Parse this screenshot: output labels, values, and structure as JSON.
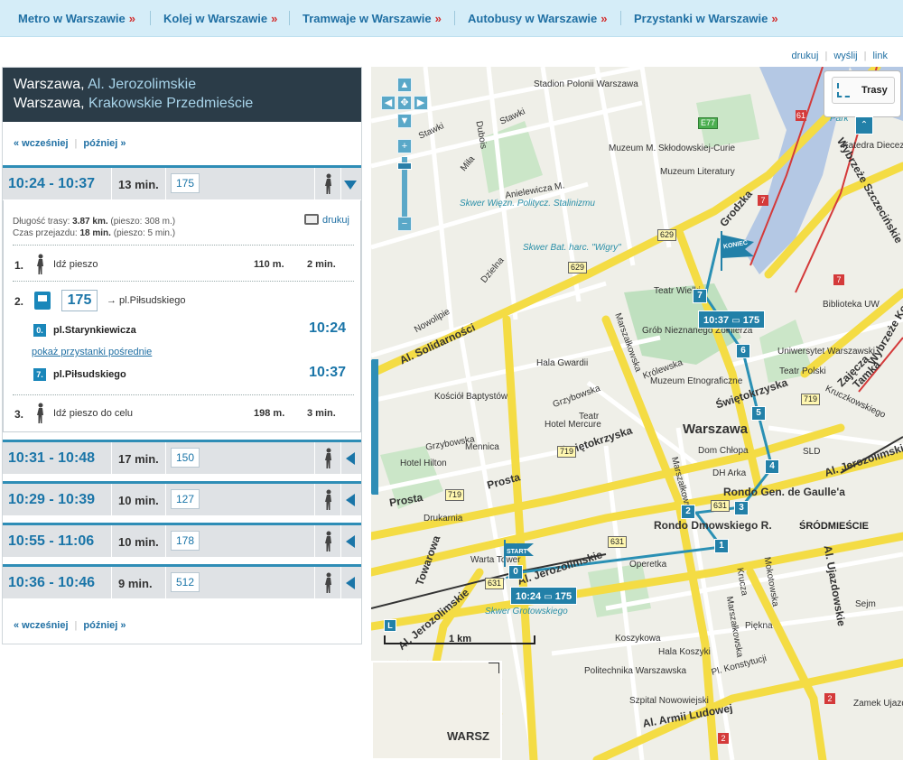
{
  "nav": [
    {
      "label": "Metro w Warszawie"
    },
    {
      "label": "Kolej w Warszawie"
    },
    {
      "label": "Tramwaje w Warszawie"
    },
    {
      "label": "Autobusy w Warszawie"
    },
    {
      "label": "Przystanki w Warszawie"
    }
  ],
  "nav_arrow": "»",
  "utils": {
    "print": "drukuj",
    "send": "wyślij",
    "link": "link"
  },
  "route": {
    "city1": "Warszawa,",
    "from": "Al. Jerozolimskie",
    "city2": "Warszawa,",
    "to": "Krakowskie Przedmieście"
  },
  "pager": {
    "earlier": "« wcześniej",
    "later": "później »"
  },
  "trips": [
    {
      "time": "10:24 - 10:37",
      "duration": "13 min.",
      "line": "175",
      "expanded": true
    },
    {
      "time": "10:31 - 10:48",
      "duration": "17 min.",
      "line": "150"
    },
    {
      "time": "10:29 - 10:39",
      "duration": "10 min.",
      "line": "127"
    },
    {
      "time": "10:55 - 11:06",
      "duration": "10 min.",
      "line": "178"
    },
    {
      "time": "10:36 - 10:46",
      "duration": "9 min.",
      "line": "512"
    }
  ],
  "detail": {
    "length_label": "Długość trasy:",
    "length_value": "3.87 km.",
    "length_walk": "(pieszo: 308 m.)",
    "time_label": "Czas przejazdu:",
    "time_value": "18 min.",
    "time_walk": "(pieszo: 5 min.)",
    "print": "drukuj",
    "steps": [
      {
        "n": "1.",
        "text": "Idź pieszo",
        "dist": "110 m.",
        "dur": "2 min."
      },
      {
        "n": "2.",
        "line": "175",
        "direction": "→ pl.Piłsudskiego",
        "stop_from_no": "0.",
        "stop_from": "pl.Starynkiewicza",
        "time_from": "10:24",
        "show_mid": "pokaż przystanki pośrednie",
        "stop_to_no": "7.",
        "stop_to": "pl.Piłsudskiego",
        "time_to": "10:37"
      },
      {
        "n": "3.",
        "text": "Idź pieszo do celu",
        "dist": "198 m.",
        "dur": "3 min."
      }
    ]
  },
  "map": {
    "trasy_label": "Trasy",
    "scale_label": "1 km",
    "start_tag": "10:24",
    "end_tag": "10:37",
    "line": "175",
    "start_flag": "START",
    "end_flag": "KONIEC",
    "labels": {
      "stadion": "Stadion Polonii Warszawa",
      "muzeum_sklod": "Muzeum M. Skłodowskiej-Curie",
      "muzeum_lit": "Muzeum Literatury",
      "skwer_wiezn": "Skwer Więzn. Politycz. Stalinizmu",
      "skwer_bat": "Skwer Bat. harc. \"Wigry\"",
      "teatr_wielki": "Teatr Wielki",
      "grob": "Grób Nieznanego Żołnierza",
      "uniw": "Uniwersytet Warszawski",
      "teatr_polski": "Teatr Polski",
      "bib": "Biblioteka UW",
      "hala_gwardii": "Hala Gwardii",
      "muzeum_etno": "Muzeum Etnograficzne",
      "kosciol": "Kościół Baptystów",
      "teatr": "Teatr",
      "hotel_mercure": "Hotel Mercure",
      "warszawa": "Warszawa",
      "dom_chlopa": "Dom Chłopa",
      "dh_arka": "DH Arka",
      "sld": "SLD",
      "rondo_gaulle": "Rondo Gen. de Gaulle'a",
      "srodmiescie": "ŚRÓDMIEŚCIE",
      "hotel_hilton": "Hotel Hilton",
      "mennica": "Mennica",
      "drukarnia": "Drukarnia",
      "rondo_dmowskiego": "Rondo Dmowskiego R.",
      "al_solidarnosci": "Al. Solidarności",
      "swietokrzyska": "Świętokrzyska",
      "prosta": "Prosta",
      "al_jerozolimskie": "Al. Jerozolimskie",
      "towarowa": "Towarowa",
      "grodzka": "Grodzka",
      "zajecza": "Zajęcza",
      "tamka": "Tamka",
      "warta": "Warta Tower",
      "operetka": "Operetka",
      "skwer_grot": "Skwer Grotowskiego",
      "koszykowa": "Koszykowa",
      "hala_koszyki": "Hala Koszyki",
      "politechnika": "Politechnika Warszawska",
      "szpital": "Szpital Nowowiejski",
      "piekna": "Piękna",
      "al_armii": "Al. Armii Ludowej",
      "pl_konst": "Pl. Konstytucji",
      "zamek": "Zamek Ujazdów",
      "sejm": "Sejm",
      "katedra": "Katedra Diecezj.",
      "park": "Park",
      "wybrzeze": "Wybrzeże Szczecińskie",
      "wybrzeze2": "Wybrzeże Ko",
      "grzybowska": "Grzybowska",
      "krolewska": "Królewska",
      "marszalkowska": "Marszałkowska",
      "nowolipie": "Nowolipie",
      "dzielna": "Dzielna",
      "mila": "Miła",
      "stawki": "Stawki",
      "anielewicza": "Anielewicza M.",
      "dubois": "Dubois",
      "mokotowska": "Mokotowska",
      "krucza": "Krucza",
      "ujazdowskie": "Al. Ujazdowskie",
      "kruczkowskiego": "Kruczkowskiego",
      "warsz_ov": "WARSZ"
    },
    "shields": [
      "629",
      "629",
      "719",
      "719",
      "719",
      "631",
      "631",
      "631",
      "E77"
    ],
    "stops": [
      "0",
      "1",
      "2",
      "3",
      "4",
      "5",
      "6",
      "7"
    ],
    "overview_label": "WARSZ"
  }
}
